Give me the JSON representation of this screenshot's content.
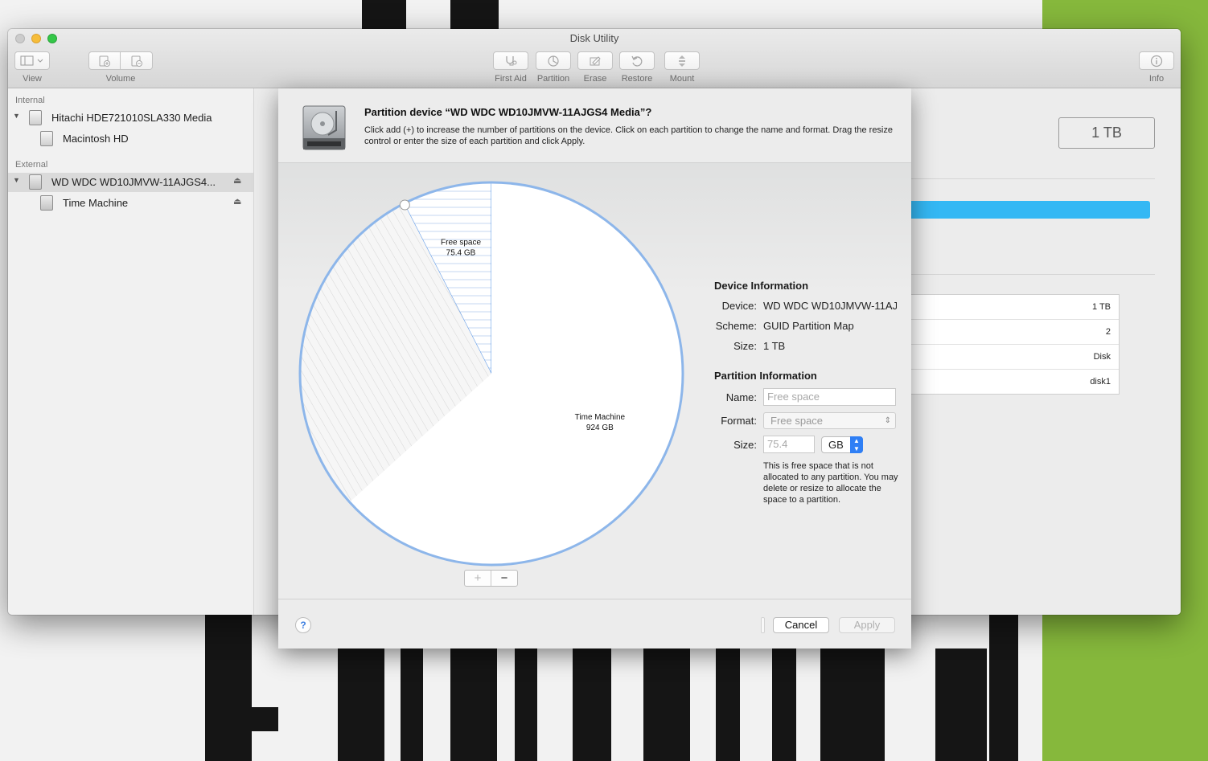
{
  "window": {
    "title": "Disk Utility"
  },
  "toolbar": {
    "view_label": "View",
    "volume_label": "Volume",
    "first_aid_label": "First Aid",
    "partition_label": "Partition",
    "erase_label": "Erase",
    "restore_label": "Restore",
    "mount_label": "Mount",
    "info_label": "Info"
  },
  "sidebar": {
    "internal_header": "Internal",
    "external_header": "External",
    "items": [
      {
        "label": "Hitachi HDE721010SLA330 Media",
        "icon": "internal-disk-icon"
      },
      {
        "label": "Macintosh HD",
        "icon": "internal-volume-icon"
      },
      {
        "label": "WD WDC WD10JMVW-11AJGS4...",
        "icon": "external-disk-icon",
        "selected": true
      },
      {
        "label": "Time Machine",
        "icon": "external-volume-icon"
      }
    ],
    "eject_glyph": "⏏"
  },
  "content": {
    "capacity": "1 TB",
    "info_values": [
      "1 TB",
      "2",
      "Disk",
      "disk1"
    ]
  },
  "sheet": {
    "title": "Partition device “WD WDC WD10JMVW-11AJGS4 Media”?",
    "description": "Click add (+) to increase the number of partitions on the device. Click on each partition to change the name and format. Drag the resize control or enter the size of each partition and click Apply.",
    "pie": {
      "slices": [
        {
          "name": "Free space",
          "size": "75.4 GB",
          "value": 75.4,
          "selected": true
        },
        {
          "name": "Time Machine",
          "size": "924 GB",
          "value": 924
        },
        {
          "name": "",
          "size": "",
          "value": 0.6,
          "hatched": true
        }
      ]
    },
    "add_button": "+",
    "remove_button": "−",
    "device_info": {
      "heading": "Device Information",
      "device_label": "Device:",
      "device_value": "WD WDC WD10JMVW-11AJGS4 Media",
      "scheme_label": "Scheme:",
      "scheme_value": "GUID Partition Map",
      "size_label": "Size:",
      "size_value": "1 TB"
    },
    "partition_info": {
      "heading": "Partition Information",
      "name_label": "Name:",
      "name_placeholder": "Free space",
      "format_label": "Format:",
      "format_value": "Free space",
      "size_label": "Size:",
      "size_value": "75.4",
      "size_unit": "GB",
      "note": "This is free space that is not allocated to any partition. You may delete or resize to allocate the space to a partition."
    },
    "help_glyph": "?",
    "cancel_label": "Cancel",
    "apply_label": "Apply"
  },
  "colors": {
    "accent": "#2f7ff5",
    "pie_outline": "#8db6ea",
    "capacity_bar": "#34b8f4",
    "desktop_green": "#86b83c"
  }
}
